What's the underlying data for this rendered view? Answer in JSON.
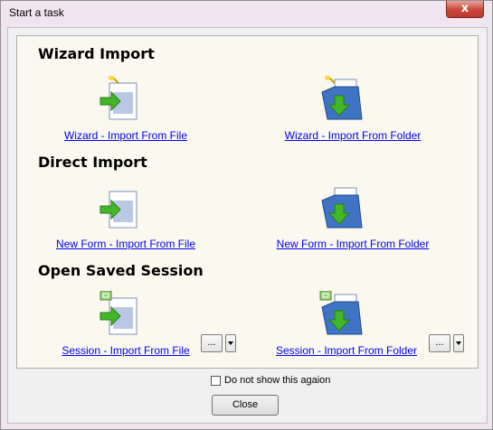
{
  "window": {
    "title": "Start a task",
    "close_glyph": "x"
  },
  "sections": {
    "wizard": {
      "title": "Wizard Import",
      "file_link": "Wizard - Import From File",
      "folder_link": "Wizard - Import From Folder "
    },
    "direct": {
      "title": "Direct Import",
      "file_link": "New Form - Import From File",
      "folder_link": "New Form - Import From Folder"
    },
    "session": {
      "title": "Open Saved Session",
      "file_link": "Session - Import From File",
      "folder_link": "Session - Import From Folder",
      "browse_label": "..."
    }
  },
  "footer": {
    "checkbox_label": "Do not show this agaion",
    "checkbox_checked": false,
    "close_button": "Close"
  },
  "colors": {
    "link": "#0000ee",
    "panel_bg": "#fbf9ef",
    "frame_bg": "#f0e4ef"
  },
  "icons": [
    "file-import-icon",
    "folder-import-icon",
    "wizard-wand-icon",
    "session-icon"
  ]
}
